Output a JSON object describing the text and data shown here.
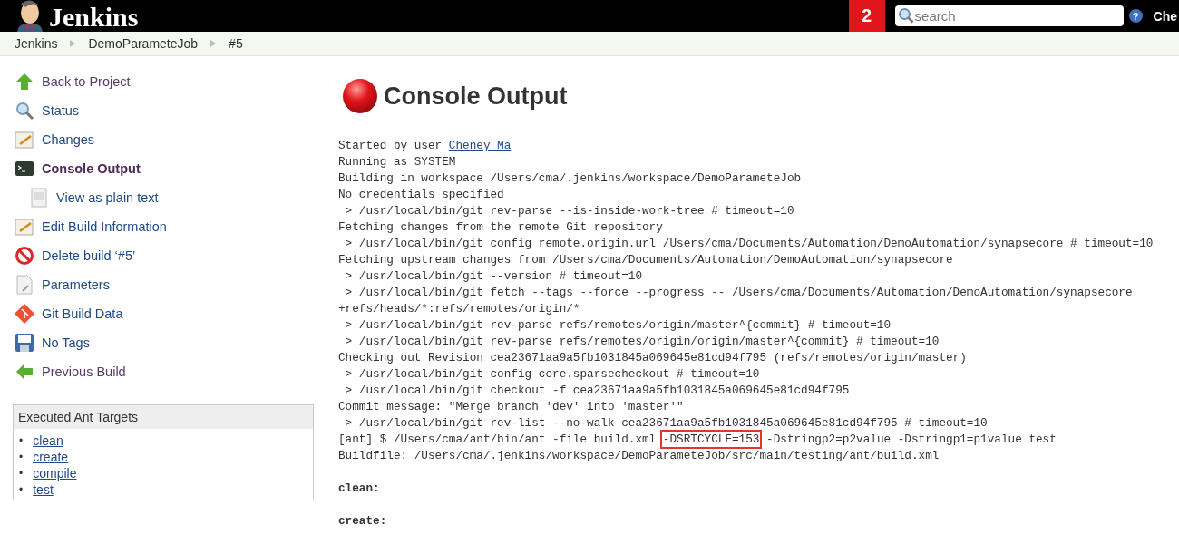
{
  "header": {
    "logo": "Jenkins",
    "badge": "2",
    "search": {
      "placeholder": "search"
    },
    "help": "?",
    "user": "Che"
  },
  "breadcrumbs": [
    "Jenkins",
    "DemoParameteJob",
    "#5"
  ],
  "sidebar": {
    "items": [
      {
        "label": "Back to Project",
        "selected": false
      },
      {
        "label": "Status",
        "selected": false
      },
      {
        "label": "Changes",
        "selected": false
      },
      {
        "label": "Console Output",
        "selected": true,
        "children": [
          {
            "label": "View as plain text",
            "selected": false
          }
        ]
      },
      {
        "label": "Edit Build Information",
        "selected": false
      },
      {
        "label": "Delete build ‘#5’",
        "selected": false
      },
      {
        "label": "Parameters",
        "selected": false
      },
      {
        "label": "Git Build Data",
        "selected": false
      },
      {
        "label": "No Tags",
        "selected": false
      },
      {
        "label": "Previous Build",
        "selected": false
      }
    ]
  },
  "targets": {
    "title": "Executed Ant Targets",
    "marker": "•",
    "items": [
      "clean",
      "create",
      "compile",
      "test"
    ]
  },
  "console": {
    "title": "Console Output",
    "lines": [
      {
        "kind": "user",
        "text": "Started by user ",
        "link": "Cheney Ma"
      },
      {
        "kind": "plain",
        "text": "Running as SYSTEM"
      },
      {
        "kind": "plain",
        "text": "Building in workspace /Users/cma/.jenkins/workspace/DemoParameteJob"
      },
      {
        "kind": "plain",
        "text": "No credentials specified"
      },
      {
        "kind": "plain",
        "text": " > /usr/local/bin/git rev-parse --is-inside-work-tree # timeout=10"
      },
      {
        "kind": "plain",
        "text": "Fetching changes from the remote Git repository"
      },
      {
        "kind": "plain",
        "text": " > /usr/local/bin/git config remote.origin.url /Users/cma/Documents/Automation/DemoAutomation/synapsecore # timeout=10"
      },
      {
        "kind": "plain",
        "text": "Fetching upstream changes from /Users/cma/Documents/Automation/DemoAutomation/synapsecore"
      },
      {
        "kind": "plain",
        "text": " > /usr/local/bin/git --version # timeout=10"
      },
      {
        "kind": "plain",
        "text": " > /usr/local/bin/git fetch --tags --force --progress -- /Users/cma/Documents/Automation/DemoAutomation/synapsecore"
      },
      {
        "kind": "plain",
        "text": "+refs/heads/*:refs/remotes/origin/*"
      },
      {
        "kind": "plain",
        "text": " > /usr/local/bin/git rev-parse refs/remotes/origin/master^{commit} # timeout=10"
      },
      {
        "kind": "plain",
        "text": " > /usr/local/bin/git rev-parse refs/remotes/origin/origin/master^{commit} # timeout=10"
      },
      {
        "kind": "plain",
        "text": "Checking out Revision cea23671aa9a5fb1031845a069645e81cd94f795 (refs/remotes/origin/master)"
      },
      {
        "kind": "plain",
        "text": " > /usr/local/bin/git config core.sparsecheckout # timeout=10"
      },
      {
        "kind": "plain",
        "text": " > /usr/local/bin/git checkout -f cea23671aa9a5fb1031845a069645e81cd94f795"
      },
      {
        "kind": "plain",
        "text": "Commit message: \"Merge branch 'dev' into 'master'\""
      },
      {
        "kind": "plain",
        "text": " > /usr/local/bin/git rev-list --no-walk cea23671aa9a5fb1031845a069645e81cd94f795 # timeout=10"
      },
      {
        "kind": "marked",
        "text": "[ant] $ /Users/cma/ant/bin/ant -file build.xml ",
        "mark": "-DSRTCYCLE=153",
        "after": " -Dstringp2=p2value -Dstringp1=p1value test"
      },
      {
        "kind": "plain",
        "text": "Buildfile: /Users/cma/.jenkins/workspace/DemoParameteJob/src/main/testing/ant/build.xml"
      },
      {
        "kind": "target",
        "text": "clean:"
      },
      {
        "kind": "target",
        "text": "create:"
      }
    ]
  }
}
